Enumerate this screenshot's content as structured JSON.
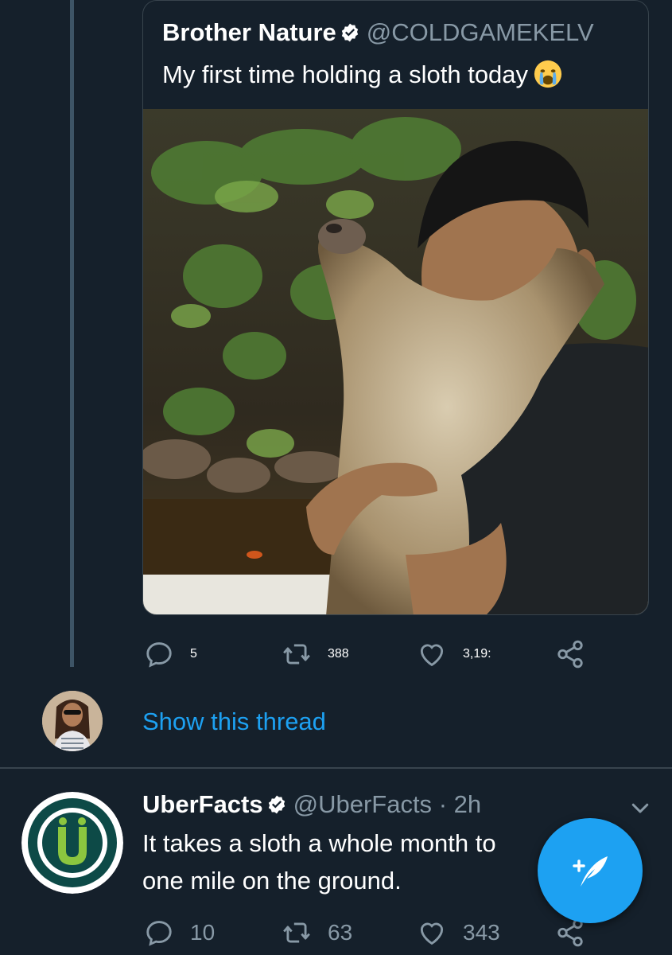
{
  "quoted_tweet": {
    "name": "Brother Nature",
    "handle": "@COLDGAMEKELV",
    "text": "My first time holding a sloth today",
    "emoji": "crying-face-emoji"
  },
  "tweet_actions": {
    "replies": "5",
    "retweets": "388",
    "likes": "3,19:"
  },
  "thread": {
    "show_thread_label": "Show this thread"
  },
  "uberfacts_tweet": {
    "name": "UberFacts",
    "handle": "@UberFacts",
    "separator": "·",
    "time": "2h",
    "text_line1": "It takes a sloth a whole month to",
    "text_line2": "one mile on the ground.",
    "replies": "10",
    "retweets": "63",
    "likes": "343"
  },
  "colors": {
    "background": "#15202b",
    "accent": "#1da1f2",
    "muted": "#8899a6",
    "brand_green": "#8cc63f",
    "brand_teal": "#0d4a47"
  },
  "icons": {
    "reply": "reply-icon",
    "retweet": "retweet-icon",
    "like": "heart-icon",
    "share": "share-icon",
    "verified": "verified-badge-icon",
    "compose": "compose-tweet-icon",
    "menu": "chevron-down-icon"
  }
}
